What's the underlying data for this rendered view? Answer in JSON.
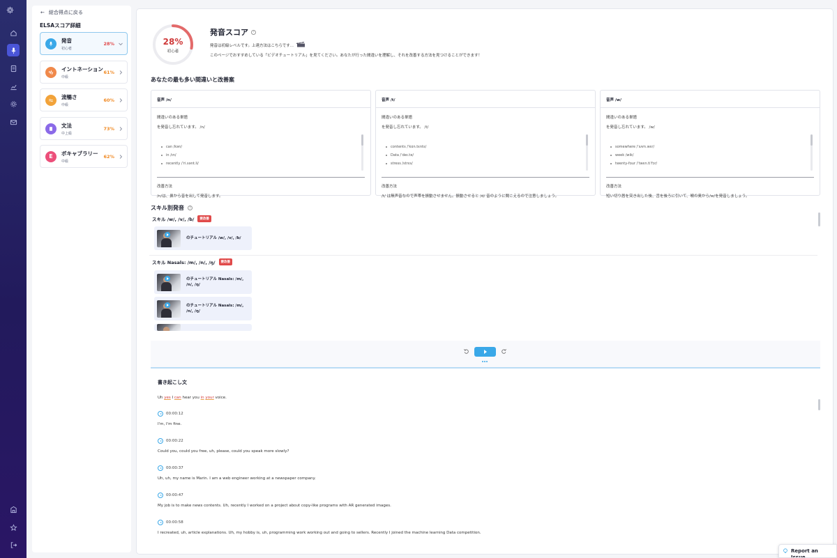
{
  "nav": {
    "back_label": "総合得点に戻る",
    "panel_title": "ELSAスコア詳細",
    "skills": [
      {
        "name": "発音",
        "level": "初心者",
        "pct": "28%",
        "color": "#e04a4a",
        "icon_color": "#3aa8e8",
        "icon": "mic-icon"
      },
      {
        "name": "イントネーション",
        "level": "中級",
        "pct": "61%",
        "color": "#f08a24",
        "icon_color": "#f0894b",
        "icon": "wave-icon"
      },
      {
        "name": "流暢さ",
        "level": "中級",
        "pct": "60%",
        "color": "#f08a24",
        "icon_color": "#f2a33a",
        "icon": "flow-icon"
      },
      {
        "name": "文法",
        "level": "中上級",
        "pct": "73%",
        "color": "#f08a24",
        "icon_color": "#8b6ae8",
        "icon": "book-icon"
      },
      {
        "name": "ボキャブラリー",
        "level": "中級",
        "pct": "62%",
        "color": "#f08a24",
        "icon_color": "#ec4f7a",
        "icon_letter": "E"
      }
    ]
  },
  "score": {
    "pct": "28%",
    "progress": 0.28,
    "level": "初心者",
    "title": "発音スコア",
    "desc1": "発音は初級レベルです。上達方法はこちらです...",
    "desc2": "このページでおすすめしている「ビデオチュートリアル」を見てください。あなたが行った間違いを理解し、それを改善する方法を見つけることができます！"
  },
  "mistakes": {
    "title": "あなたの最も多い間違いと改善案",
    "cards": [
      {
        "head": "音声 /n/",
        "words_label": "間違いのある単語",
        "missed": "を発音し忘れています。 /n/",
        "words": [
          "can /kən/",
          "in /ɪn/",
          "recently /ˈri.sənt.li/"
        ],
        "fix_label": "改善方法",
        "fix": "/n/は、鼻から音を出して発音します。"
      },
      {
        "head": "音声 /t/",
        "words_label": "間違いのある単語",
        "missed": "を発音し忘れています。 /t/",
        "words": [
          "contents /ˈkɑn.tɛnts/",
          "Data /ˈdeɪ.tə/",
          "stress /strɛs/"
        ],
        "fix_label": "改善方法",
        "fix": "/t/ は無声音なので声帯を振動させません。振動させると /d/ 音のように聞こえるので注意しましょう。"
      },
      {
        "head": "音声 /w/",
        "words_label": "間違いのある単語",
        "missed": "を発音し忘れています。 /w/",
        "words": [
          "somewhere /ˈsʌm.wɛr/",
          "week /wik/",
          "twenty-four /ˈtwɛn.tiˈfɔr/"
        ],
        "fix_label": "改善方法",
        "fix": "短い切り唇を突き出した後、舌を後ろに引いて、喉の奥から/w/を発音しましょう。"
      }
    ]
  },
  "skills_section": {
    "title": "スキル別発音",
    "groups": [
      {
        "label": "スキル /w/, /v/, /b/",
        "badge": "要改善",
        "videos": [
          "のチュートリアル /w/, /v/, /b/"
        ]
      },
      {
        "label": "スキル Nasals: /m/, /n/, /ŋ/",
        "badge": "要改善",
        "videos": [
          "のチュートリアル Nasals: /m/, /n/, /ŋ/",
          "のチュートリアル Nasals: /m/, /n/, /ŋ/"
        ]
      }
    ]
  },
  "transcript": {
    "title": "書き起こし文",
    "first_line": {
      "pre": "Uh ",
      "e1": "yes",
      "m1": " I ",
      "e2": "can",
      "m2": " hear you ",
      "e3": "in",
      "m3": " ",
      "e4": "your",
      "post": " voice."
    },
    "entries": [
      {
        "time": "00:00:12",
        "text": "I'm, I'm fine."
      },
      {
        "time": "00:00:22",
        "text": "Could you, could you free, uh, please, could you speak more slowly?"
      },
      {
        "time": "00:00:37",
        "text": "Uh, uh, my name is Marin. I am a web engineer working at a newspaper company."
      },
      {
        "time": "00:00:47",
        "text": "My job is to make news contents. Uh, recently I worked on a project about copy-like programs with AR generated images."
      },
      {
        "time": "00:00:58",
        "text": "I recreated, uh, article explanations. Uh, my hobby is, uh, programming work working out and going to sellers. Recently I joined the machine learning Data competition."
      }
    ]
  },
  "report": {
    "label": "Report an Issue"
  }
}
